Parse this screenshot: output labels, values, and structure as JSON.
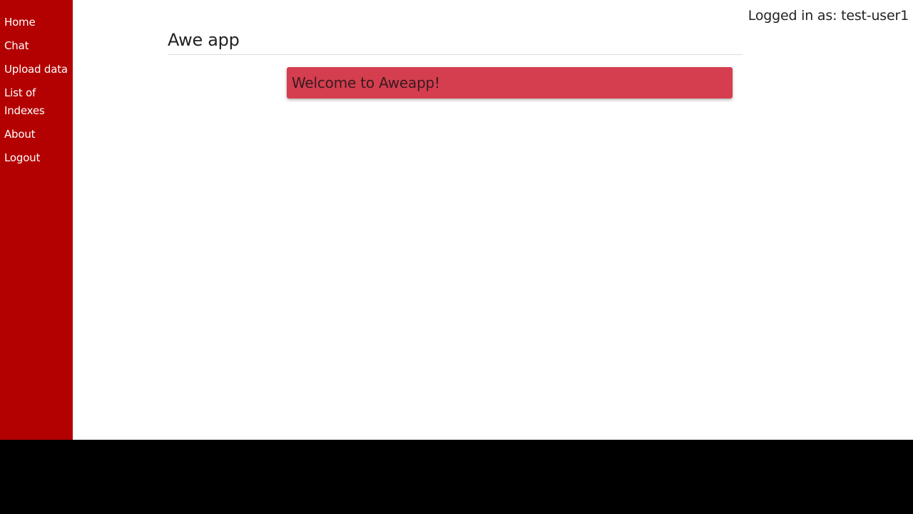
{
  "colors": {
    "sidebar_bg": "#b30000",
    "alert_bg": "#d43e4f",
    "page_bg": "#ffffff"
  },
  "sidebar": {
    "items": [
      {
        "label": "Home"
      },
      {
        "label": "Chat"
      },
      {
        "label": "Upload data"
      },
      {
        "label": "List of Indexes"
      },
      {
        "label": "About"
      },
      {
        "label": "Logout"
      }
    ]
  },
  "header": {
    "user_status": "Logged in as: test-user1",
    "title": "Awe app"
  },
  "main": {
    "alert_message": "Welcome to Aweapp!"
  }
}
